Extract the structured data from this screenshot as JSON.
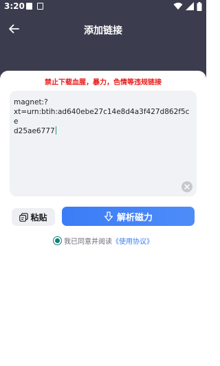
{
  "status_bar": {
    "time": "3:20",
    "icons": [
      "notification-square-icon",
      "notification-app-icon",
      "wifi-icon",
      "signal-icon",
      "battery-icon"
    ]
  },
  "nav": {
    "back_icon": "arrow-left-icon",
    "title": "添加链接"
  },
  "warning": "禁止下载血腥，暴力，色情等违规链接",
  "input": {
    "value": "magnet:?xt=urn:btih:ad640ebe27c14e8d4a3f427d862f5ced25ae6777",
    "line1": "magnet:?",
    "line2": "xt=urn:btih:ad640ebe27c14e8d4a3f427d862f5ce",
    "line3": "d25ae6777",
    "clear_icon": "clear-icon"
  },
  "buttons": {
    "paste_label": "粘贴",
    "paste_icon": "clipboard-icon",
    "parse_label": "解析磁力",
    "parse_icon": "download-arrow-icon"
  },
  "agreement": {
    "checked": true,
    "text": "我已同意并阅读",
    "link": "《使用协议》"
  },
  "colors": {
    "header_bg": "#3b3d4e",
    "warning_red": "#e81c1c",
    "primary_blue": "#3c7cf6",
    "radio_teal": "#0f7f78",
    "link_blue": "#3a7cf2",
    "input_bg": "#f1f2f6"
  }
}
